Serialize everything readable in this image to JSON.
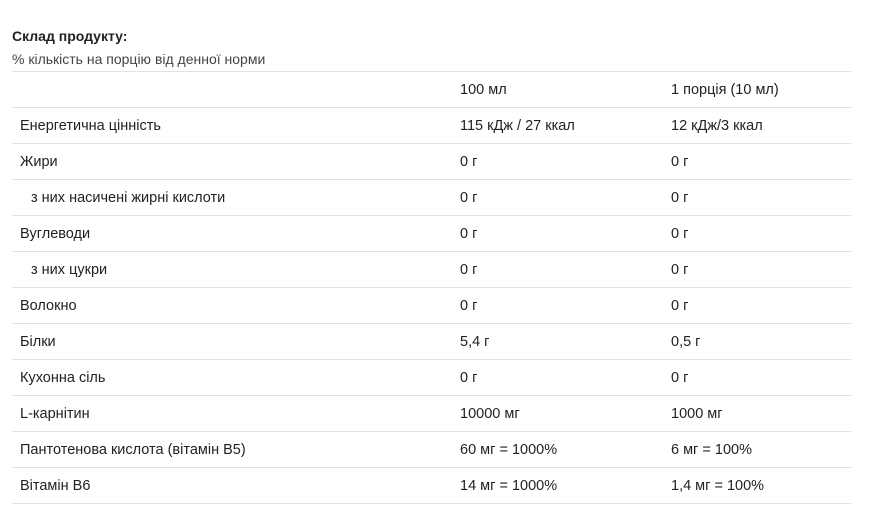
{
  "title": "Склад продукту:",
  "subtitle": "% кількість на порцію від денної норми",
  "table": {
    "headers": [
      "",
      "100 мл",
      "1 порція (10 мл)"
    ],
    "rows": [
      {
        "name": "Енергетична цінність",
        "per100": "115 кДж / 27 ккал",
        "perServing": "12 кДж/3 ккал",
        "indent": false
      },
      {
        "name": "Жири",
        "per100": "0 г",
        "perServing": "0 г",
        "indent": false
      },
      {
        "name": "з них насичені жирні кислоти",
        "per100": "0 г",
        "perServing": "0 г",
        "indent": true
      },
      {
        "name": "Вуглеводи",
        "per100": "0 г",
        "perServing": "0 г",
        "indent": false
      },
      {
        "name": "з них цукри",
        "per100": "0 г",
        "perServing": "0 г",
        "indent": true
      },
      {
        "name": "Волокно",
        "per100": "0 г",
        "perServing": "0 г",
        "indent": false
      },
      {
        "name": "Білки",
        "per100": "5,4 г",
        "perServing": "0,5 г",
        "indent": false
      },
      {
        "name": "Кухонна сіль",
        "per100": "0 г",
        "perServing": "0 г",
        "indent": false
      },
      {
        "name": "L-карнітин",
        "per100": "10000 мг",
        "perServing": "1000 мг",
        "indent": false
      },
      {
        "name": "Пантотенова кислота (вітамін B5)",
        "per100": "60 мг = 1000%",
        "perServing": "6 мг = 100%",
        "indent": false
      },
      {
        "name": "Вітамін B6",
        "per100": "14 мг = 1000%",
        "perServing": "1,4 мг = 100%",
        "indent": false
      }
    ]
  }
}
